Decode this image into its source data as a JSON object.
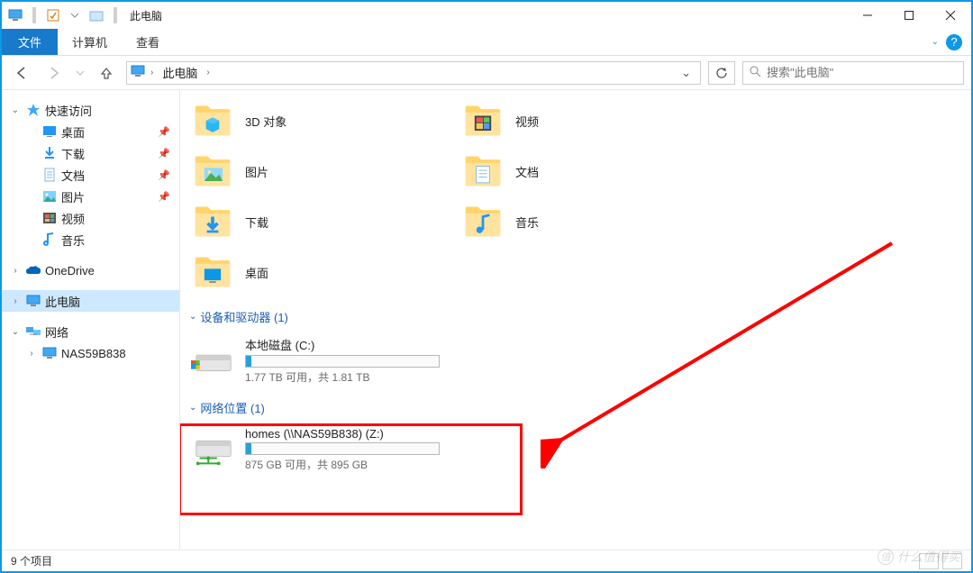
{
  "window": {
    "title": "此电脑"
  },
  "ribbon": {
    "file": "文件",
    "computer": "计算机",
    "view": "查看"
  },
  "breadcrumbs": {
    "root": "此电脑"
  },
  "search": {
    "placeholder": "搜索\"此电脑\""
  },
  "sidebar": {
    "quick_access": "快速访问",
    "desktop": "桌面",
    "downloads": "下载",
    "documents": "文档",
    "pictures": "图片",
    "videos": "视频",
    "music": "音乐",
    "onedrive": "OneDrive",
    "this_pc": "此电脑",
    "network": "网络",
    "nas_host": "NAS59B838"
  },
  "folders": {
    "objects3d": "3D 对象",
    "videos": "视频",
    "pictures": "图片",
    "documents": "文档",
    "downloads": "下载",
    "music": "音乐",
    "desktop": "桌面"
  },
  "groups": {
    "devices": "设备和驱动器 (1)",
    "network_locations": "网络位置 (1)"
  },
  "drives": {
    "c": {
      "name": "本地磁盘 (C:)",
      "status": "1.77 TB 可用，共 1.81 TB",
      "fill_pct": 3
    },
    "z": {
      "name": "homes (\\\\NAS59B838) (Z:)",
      "status": "875 GB 可用，共 895 GB",
      "fill_pct": 3
    }
  },
  "statusbar": {
    "items": "9 个项目"
  },
  "watermark": "什么值得买"
}
